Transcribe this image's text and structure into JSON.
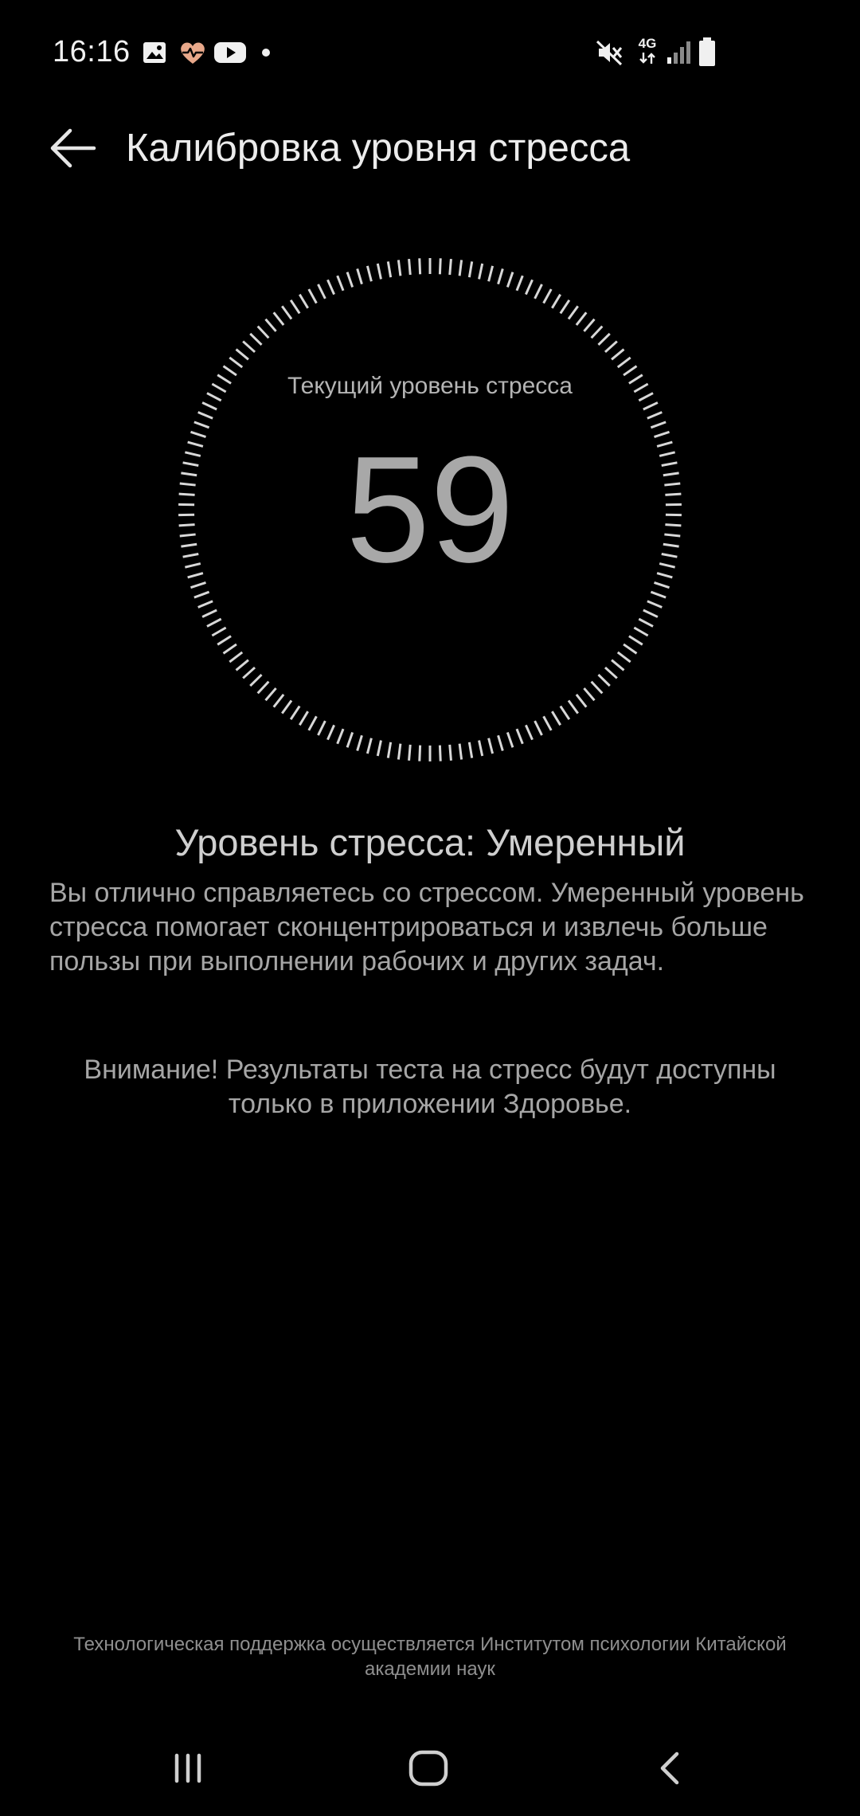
{
  "status_bar": {
    "time": "16:16",
    "left_icons": [
      "gallery-icon",
      "health-heart-icon",
      "youtube-icon",
      "notification-dot-icon"
    ],
    "right_icons": [
      "vibrate-mute-icon",
      "network-4g-icon",
      "signal-icon",
      "battery-icon"
    ],
    "network_label": "4G"
  },
  "header": {
    "back_icon": "arrow-left-icon",
    "title": "Калибровка уровня стресса"
  },
  "gauge": {
    "caption": "Текущий уровень стресса",
    "value": "59"
  },
  "result": {
    "heading": "Уровень стресса: Умеренный",
    "description": "Вы отлично справляетесь со стрессом. Умеренный уровень стресса помогает сконцентрироваться и извлечь больше пользы при выполнении рабочих и других задач."
  },
  "notice": {
    "text": "Внимание! Результаты теста на стресс будут доступны только в приложении Здоровье."
  },
  "credit": {
    "text": "Технологическая поддержка осуществляется Институтом психологии Китайской академии наук"
  },
  "nav_bar": {
    "recents_icon": "recents-icon",
    "home_icon": "home-icon",
    "back_icon": "back-chevron-icon"
  },
  "colors": {
    "background": "#000000",
    "title_text": "#ececec",
    "body_text": "#a6a6a6",
    "tick": "#d8d8d8",
    "health_accent": "#e8a88a"
  }
}
